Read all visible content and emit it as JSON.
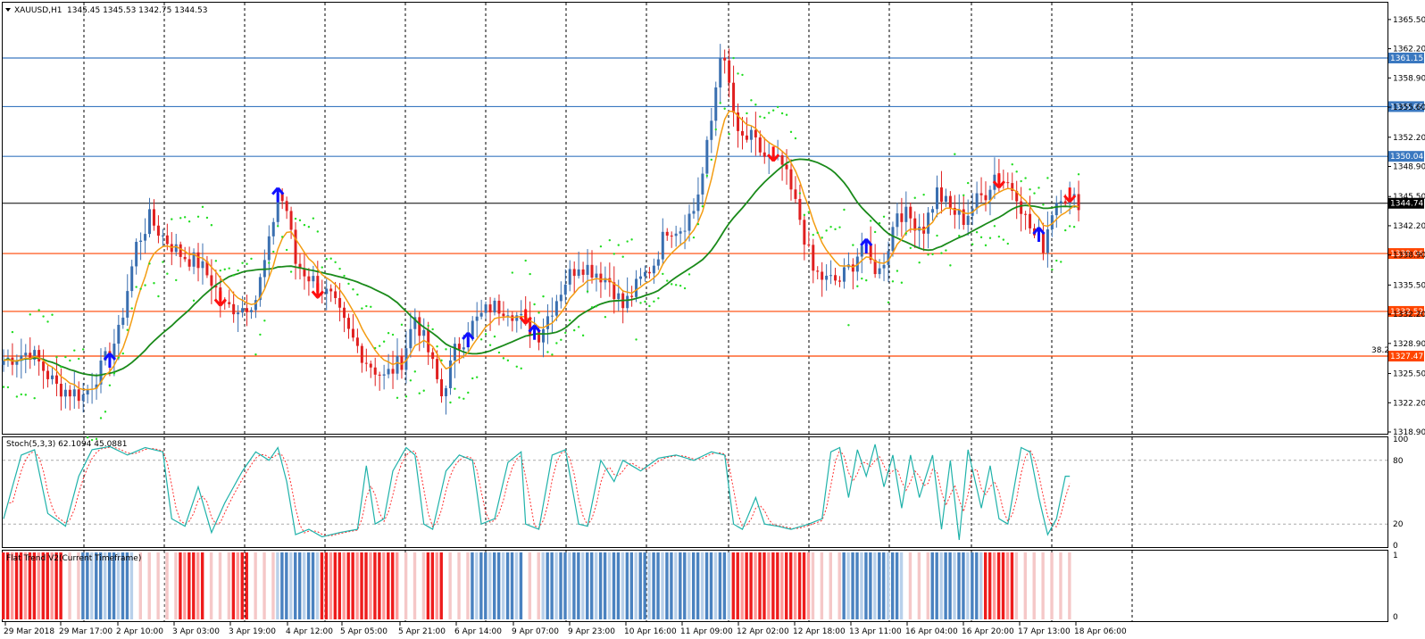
{
  "header": {
    "symbol": "XAUUSD,H1",
    "ohlc": "1345.45 1345.53 1342.75 1344.53"
  },
  "colors": {
    "up_candle": "#3a6fb0",
    "down_candle": "#e02020",
    "ema_fast": "#f39c12",
    "ma_slow": "#1a8a1a",
    "sar": "#22dd22",
    "level_blue": "#3a78c0",
    "level_red": "#ff4500",
    "buy_arrow": "#1010ff",
    "sell_arrow": "#ff1010",
    "stoch_main": "#20b2aa",
    "stoch_signal": "#ff3030"
  },
  "chart_data": {
    "type": "candlestick",
    "price_axis": {
      "ticks": [
        "1365.50",
        "1362.20",
        "1358.90",
        "1355.60",
        "1352.20",
        "1348.90",
        "1345.50",
        "1342.20",
        "1338.90",
        "1335.50",
        "1332.20",
        "1328.90",
        "1325.50",
        "1322.20",
        "1318.90"
      ],
      "range": [
        1318.9,
        1367.1
      ],
      "current_price": "1344.74"
    },
    "levels": [
      {
        "value": "1361.15",
        "color": "blue"
      },
      {
        "value": "1355.66",
        "color": "blue"
      },
      {
        "value": "1350.04",
        "color": "blue"
      },
      {
        "value": "1339.06",
        "color": "red"
      },
      {
        "value": "1332.52",
        "color": "red"
      },
      {
        "value": "1327.47",
        "color": "red",
        "tag": "38.2"
      }
    ],
    "time_labels": [
      "29 Mar 2018",
      "29 Mar 17:00",
      "2 Apr 10:00",
      "3 Apr 03:00",
      "3 Apr 19:00",
      "4 Apr 12:00",
      "5 Apr 05:00",
      "5 Apr 21:00",
      "6 Apr 14:00",
      "9 Apr 07:00",
      "9 Apr 23:00",
      "10 Apr 16:00",
      "11 Apr 09:00",
      "12 Apr 02:00",
      "12 Apr 18:00",
      "13 Apr 11:00",
      "16 Apr 04:00",
      "16 Apr 20:00",
      "17 Apr 13:00",
      "18 Apr 06:00"
    ],
    "close_path": [
      [
        0,
        1327
      ],
      [
        6,
        1328
      ],
      [
        12,
        1324
      ],
      [
        18,
        1323
      ],
      [
        22,
        1326
      ],
      [
        26,
        1330
      ],
      [
        30,
        1340
      ],
      [
        33,
        1343
      ],
      [
        36,
        1341
      ],
      [
        40,
        1339
      ],
      [
        44,
        1338
      ],
      [
        47,
        1336
      ],
      [
        50,
        1333
      ],
      [
        54,
        1333
      ],
      [
        57,
        1334
      ],
      [
        60,
        1340
      ],
      [
        62,
        1346
      ],
      [
        64,
        1344
      ],
      [
        66,
        1338
      ],
      [
        70,
        1336
      ],
      [
        74,
        1334
      ],
      [
        78,
        1330
      ],
      [
        82,
        1327
      ],
      [
        86,
        1325
      ],
      [
        90,
        1327
      ],
      [
        93,
        1332
      ],
      [
        96,
        1328
      ],
      [
        99,
        1323
      ],
      [
        102,
        1328
      ],
      [
        106,
        1331
      ],
      [
        110,
        1333
      ],
      [
        114,
        1333
      ],
      [
        118,
        1331
      ],
      [
        121,
        1330
      ],
      [
        124,
        1333
      ],
      [
        127,
        1336
      ],
      [
        130,
        1338
      ],
      [
        134,
        1337
      ],
      [
        137,
        1336
      ],
      [
        140,
        1333
      ],
      [
        144,
        1336
      ],
      [
        147,
        1338
      ],
      [
        150,
        1342
      ],
      [
        153,
        1342
      ],
      [
        156,
        1344
      ],
      [
        158,
        1348
      ],
      [
        160,
        1354
      ],
      [
        162,
        1362
      ],
      [
        164,
        1358
      ],
      [
        166,
        1352
      ],
      [
        169,
        1352
      ],
      [
        172,
        1350
      ],
      [
        176,
        1349
      ],
      [
        178,
        1346
      ],
      [
        180,
        1343
      ],
      [
        183,
        1337
      ],
      [
        186,
        1336
      ],
      [
        189,
        1336
      ],
      [
        192,
        1338
      ],
      [
        194,
        1340
      ],
      [
        196,
        1338
      ],
      [
        198,
        1337
      ],
      [
        200,
        1340
      ],
      [
        202,
        1344
      ],
      [
        205,
        1343
      ],
      [
        208,
        1342
      ],
      [
        211,
        1346
      ],
      [
        214,
        1344
      ],
      [
        217,
        1343
      ],
      [
        220,
        1345
      ],
      [
        222,
        1346
      ],
      [
        224,
        1348
      ],
      [
        227,
        1347
      ],
      [
        229,
        1346
      ],
      [
        231,
        1343
      ],
      [
        233,
        1341
      ],
      [
        235,
        1340
      ],
      [
        237,
        1344
      ],
      [
        239,
        1346
      ],
      [
        241,
        1345
      ],
      [
        243,
        1345
      ]
    ],
    "arrows": [
      {
        "type": "buy",
        "index": 24
      },
      {
        "type": "sell",
        "index": 49
      },
      {
        "type": "buy",
        "index": 62
      },
      {
        "type": "sell",
        "index": 71
      },
      {
        "type": "buy",
        "index": 105
      },
      {
        "type": "sell",
        "index": 118
      },
      {
        "type": "buy",
        "index": 120
      },
      {
        "type": "sell",
        "index": 174
      },
      {
        "type": "buy",
        "index": 195
      },
      {
        "type": "sell",
        "index": 225
      },
      {
        "type": "buy",
        "index": 234
      },
      {
        "type": "sell",
        "index": 241
      }
    ],
    "stochastic": {
      "label": "Stoch(5,3,3) 62.1094 45.0881",
      "levels": [
        "80",
        "20"
      ],
      "axis": [
        "100",
        "80",
        "20",
        "0"
      ],
      "path": [
        [
          0,
          25
        ],
        [
          4,
          85
        ],
        [
          7,
          90
        ],
        [
          10,
          30
        ],
        [
          14,
          18
        ],
        [
          17,
          65
        ],
        [
          20,
          90
        ],
        [
          24,
          93
        ],
        [
          28,
          85
        ],
        [
          32,
          92
        ],
        [
          36,
          88
        ],
        [
          38,
          25
        ],
        [
          41,
          18
        ],
        [
          44,
          55
        ],
        [
          47,
          12
        ],
        [
          50,
          40
        ],
        [
          54,
          70
        ],
        [
          57,
          88
        ],
        [
          60,
          80
        ],
        [
          62,
          92
        ],
        [
          64,
          60
        ],
        [
          66,
          10
        ],
        [
          69,
          15
        ],
        [
          72,
          8
        ],
        [
          76,
          12
        ],
        [
          80,
          15
        ],
        [
          82,
          75
        ],
        [
          84,
          20
        ],
        [
          86,
          25
        ],
        [
          88,
          70
        ],
        [
          91,
          92
        ],
        [
          93,
          85
        ],
        [
          95,
          20
        ],
        [
          97,
          15
        ],
        [
          100,
          70
        ],
        [
          103,
          85
        ],
        [
          106,
          80
        ],
        [
          108,
          20
        ],
        [
          111,
          25
        ],
        [
          114,
          78
        ],
        [
          117,
          88
        ],
        [
          118,
          20
        ],
        [
          121,
          15
        ],
        [
          124,
          85
        ],
        [
          127,
          90
        ],
        [
          130,
          20
        ],
        [
          132,
          18
        ],
        [
          135,
          80
        ],
        [
          138,
          60
        ],
        [
          140,
          80
        ],
        [
          144,
          70
        ],
        [
          148,
          82
        ],
        [
          152,
          85
        ],
        [
          156,
          80
        ],
        [
          160,
          88
        ],
        [
          163,
          85
        ],
        [
          165,
          20
        ],
        [
          167,
          15
        ],
        [
          170,
          45
        ],
        [
          172,
          20
        ],
        [
          175,
          18
        ],
        [
          178,
          15
        ],
        [
          182,
          20
        ],
        [
          185,
          25
        ],
        [
          187,
          88
        ],
        [
          189,
          92
        ],
        [
          191,
          45
        ],
        [
          193,
          90
        ],
        [
          195,
          65
        ],
        [
          197,
          95
        ],
        [
          199,
          55
        ],
        [
          201,
          85
        ],
        [
          203,
          35
        ],
        [
          205,
          85
        ],
        [
          207,
          45
        ],
        [
          210,
          85
        ],
        [
          212,
          15
        ],
        [
          214,
          80
        ],
        [
          216,
          5
        ],
        [
          218,
          90
        ],
        [
          221,
          35
        ],
        [
          223,
          75
        ],
        [
          225,
          25
        ],
        [
          227,
          20
        ],
        [
          230,
          92
        ],
        [
          232,
          88
        ],
        [
          234,
          45
        ],
        [
          236,
          10
        ],
        [
          238,
          25
        ],
        [
          240,
          65
        ]
      ]
    },
    "flat_trend": {
      "label": "Flat Trend V2(Current Timeframe)",
      "axis": [
        "1",
        "0"
      ],
      "segments": [
        {
          "start": 0,
          "end": 14,
          "state": "down"
        },
        {
          "start": 14,
          "end": 18,
          "state": "flat"
        },
        {
          "start": 18,
          "end": 30,
          "state": "up"
        },
        {
          "start": 30,
          "end": 40,
          "state": "flat"
        },
        {
          "start": 40,
          "end": 46,
          "state": "down"
        },
        {
          "start": 46,
          "end": 52,
          "state": "flat"
        },
        {
          "start": 52,
          "end": 56,
          "state": "down"
        },
        {
          "start": 56,
          "end": 62,
          "state": "flat"
        },
        {
          "start": 62,
          "end": 72,
          "state": "up"
        },
        {
          "start": 72,
          "end": 76,
          "state": "down"
        },
        {
          "start": 76,
          "end": 90,
          "state": "down"
        },
        {
          "start": 90,
          "end": 96,
          "state": "flat"
        },
        {
          "start": 96,
          "end": 100,
          "state": "down"
        },
        {
          "start": 100,
          "end": 106,
          "state": "flat"
        },
        {
          "start": 106,
          "end": 118,
          "state": "up"
        },
        {
          "start": 118,
          "end": 122,
          "state": "flat"
        },
        {
          "start": 122,
          "end": 165,
          "state": "up"
        },
        {
          "start": 165,
          "end": 183,
          "state": "down"
        },
        {
          "start": 183,
          "end": 190,
          "state": "flat"
        },
        {
          "start": 190,
          "end": 204,
          "state": "up"
        },
        {
          "start": 204,
          "end": 210,
          "state": "flat"
        },
        {
          "start": 210,
          "end": 222,
          "state": "up"
        },
        {
          "start": 222,
          "end": 229,
          "state": "down"
        },
        {
          "start": 229,
          "end": 243,
          "state": "flat"
        }
      ]
    }
  }
}
